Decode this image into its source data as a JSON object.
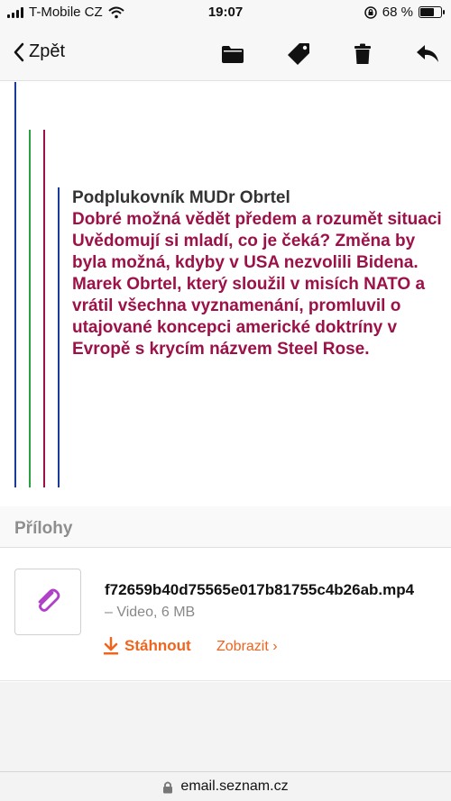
{
  "status_bar": {
    "carrier": "T-Mobile CZ",
    "time": "19:07",
    "battery": "68 %",
    "battery_level": 0.68
  },
  "toolbar": {
    "back_label": "Zpět",
    "icons": [
      "folder-icon",
      "tag-icon",
      "trash-icon",
      "reply-icon"
    ]
  },
  "quote_colors": [
    "#1a3a9c",
    "#2aa040",
    "#9c1147",
    "#1a3a9c"
  ],
  "message": {
    "author": "Podplukovník MUDr Obrtel",
    "paragraphs": [
      "Dobré možná vědět předem a rozumět situaci",
      "Uvědomují si mladí, co je čeká?  Změna by byla možná, kdyby v  USA nezvolili Bidena.",
      "Marek Obrtel, který sloužil v misích NATO a vrátil všechna vyznamenání, promluvil o utajované koncepci americké doktríny v Evropě s krycím názvem Steel Rose."
    ]
  },
  "attachments": {
    "title": "Přílohy",
    "file": {
      "name": "f72659b40d75565e017b81755c4b26ab.mp4",
      "meta": "– Video, 6 MB",
      "download_label": "Stáhnout",
      "view_label": "Zobrazit ›"
    }
  },
  "url_bar": {
    "domain": "email.seznam.cz"
  },
  "colors": {
    "accent": "#f0641e",
    "message_text": "#9c1147",
    "clip_icon": "#b040c8"
  }
}
